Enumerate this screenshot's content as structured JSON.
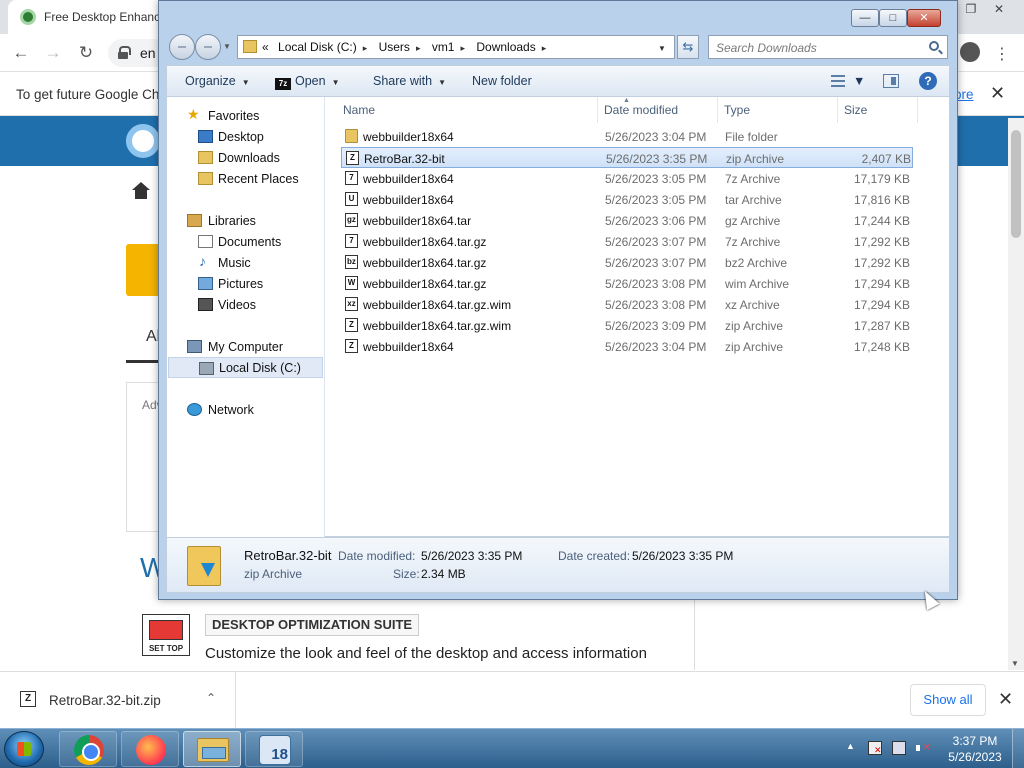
{
  "browser": {
    "tab_title": "Free Desktop Enhance",
    "url_fragment": "en",
    "infobar_message": "To get future Google Chr",
    "infobar_link": "ore",
    "window_controls": {
      "restore": "❐",
      "close": "✕"
    },
    "nav": {
      "back": "←",
      "forward": "→",
      "reload": "↻"
    },
    "kebab": "⋮",
    "close_glyph": "✕"
  },
  "page": {
    "tab_fragment": "Al",
    "ad_fragment": "Adv",
    "heading_fragment": "W",
    "set_top_label": "SET TOP",
    "suite_title": "DESKTOP OPTIMIZATION SUITE",
    "suite_description": "Customize the look and feel of the desktop and access information"
  },
  "downloads": {
    "file_name": "RetroBar.32-bit.zip",
    "file_icon_glyph": "Z",
    "chevron": "⌃",
    "show_all": "Show all",
    "close": "✕"
  },
  "explorer": {
    "title_buttons": {
      "minimize": "—",
      "maximize": "□",
      "close": "✕"
    },
    "breadcrumb": {
      "overflow": "«",
      "separator": "▸",
      "parts": [
        "Local Disk (C:)",
        "Users",
        "vm1",
        "Downloads"
      ]
    },
    "dropdown_glyph": "▼",
    "refresh_glyph": "⇆",
    "search_placeholder": "Search Downloads",
    "commands": {
      "organize": "Organize",
      "open": "Open",
      "seven_z": "7z",
      "share_with": "Share with",
      "new_folder": "New folder",
      "help": "?"
    },
    "nav_pane": {
      "favorites": "Favorites",
      "desktop": "Desktop",
      "downloads": "Downloads",
      "recent_places": "Recent Places",
      "libraries": "Libraries",
      "documents": "Documents",
      "music": "Music",
      "pictures": "Pictures",
      "videos": "Videos",
      "my_computer": "My Computer",
      "local_disk": "Local Disk (C:)",
      "network": "Network"
    },
    "columns": {
      "name": "Name",
      "date": "Date modified",
      "type": "Type",
      "size": "Size"
    },
    "files": [
      {
        "name": "webbuilder18x64",
        "date": "5/26/2023 3:04 PM",
        "type": "File folder",
        "size": "",
        "icon": "folder"
      },
      {
        "name": "RetroBar.32-bit",
        "date": "5/26/2023 3:35 PM",
        "type": "zip Archive",
        "size": "2,407 KB",
        "icon": "Z"
      },
      {
        "name": "webbuilder18x64",
        "date": "5/26/2023 3:05 PM",
        "type": "7z Archive",
        "size": "17,179 KB",
        "icon": "7"
      },
      {
        "name": "webbuilder18x64",
        "date": "5/26/2023 3:05 PM",
        "type": "tar Archive",
        "size": "17,816 KB",
        "icon": "U"
      },
      {
        "name": "webbuilder18x64.tar",
        "date": "5/26/2023 3:06 PM",
        "type": "gz Archive",
        "size": "17,244 KB",
        "icon": "gz"
      },
      {
        "name": "webbuilder18x64.tar.gz",
        "date": "5/26/2023 3:07 PM",
        "type": "7z Archive",
        "size": "17,292 KB",
        "icon": "7"
      },
      {
        "name": "webbuilder18x64.tar.gz",
        "date": "5/26/2023 3:07 PM",
        "type": "bz2 Archive",
        "size": "17,292 KB",
        "icon": "bz"
      },
      {
        "name": "webbuilder18x64.tar.gz",
        "date": "5/26/2023 3:08 PM",
        "type": "wim Archive",
        "size": "17,294 KB",
        "icon": "W"
      },
      {
        "name": "webbuilder18x64.tar.gz.wim",
        "date": "5/26/2023 3:08 PM",
        "type": "xz Archive",
        "size": "17,294 KB",
        "icon": "xz"
      },
      {
        "name": "webbuilder18x64.tar.gz.wim",
        "date": "5/26/2023 3:09 PM",
        "type": "zip Archive",
        "size": "17,287 KB",
        "icon": "Z"
      },
      {
        "name": "webbuilder18x64",
        "date": "5/26/2023 3:04 PM",
        "type": "zip Archive",
        "size": "17,248 KB",
        "icon": "Z"
      }
    ],
    "selected_index": 1,
    "details": {
      "name": "RetroBar.32-bit",
      "type": "zip Archive",
      "date_modified_label": "Date modified:",
      "date_modified": "5/26/2023 3:35 PM",
      "date_created_label": "Date created:",
      "date_created": "5/26/2023 3:35 PM",
      "size_label": "Size:",
      "size": "2.34 MB"
    }
  },
  "taskbar": {
    "webbuilder_badge": "18",
    "tray_up": "▲",
    "time": "3:37 PM",
    "date": "5/26/2023"
  }
}
